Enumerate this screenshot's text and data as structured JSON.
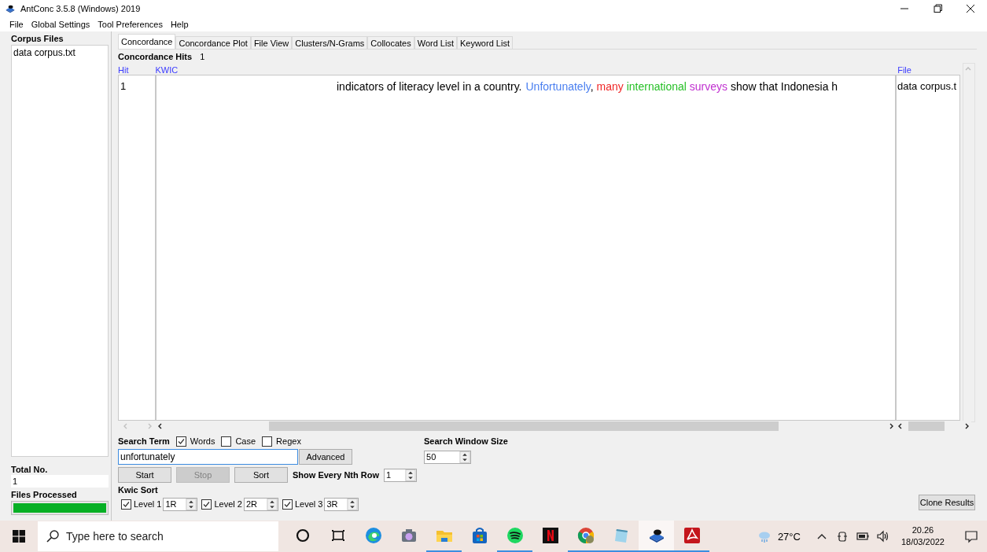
{
  "window": {
    "title": "AntConc 3.5.8 (Windows) 2019"
  },
  "menu": [
    "File",
    "Global Settings",
    "Tool Preferences",
    "Help"
  ],
  "corpus_files": {
    "heading": "Corpus Files",
    "files": [
      "data corpus.txt"
    ]
  },
  "total": {
    "label": "Total No.",
    "value": "1"
  },
  "files_processed": {
    "label": "Files Processed",
    "level": 1
  },
  "tabs": [
    {
      "label": "Concordance",
      "selected": true
    },
    {
      "label": "Concordance Plot",
      "selected": false
    },
    {
      "label": "File View",
      "selected": false
    },
    {
      "label": "Clusters/N-Grams",
      "selected": false
    },
    {
      "label": "Collocates",
      "selected": false
    },
    {
      "label": "Word List",
      "selected": false
    },
    {
      "label": "Keyword List",
      "selected": false
    }
  ],
  "hits": {
    "label": "Concordance Hits",
    "value": "1"
  },
  "table": {
    "columns": [
      "Hit",
      "KWIC",
      "File"
    ],
    "rows": [
      {
        "hit": "1",
        "left": "indicators of literacy level in a country.",
        "right": [
          {
            "text": "Unfortunately",
            "color": "#4a7ff0"
          },
          {
            "text": ","
          },
          {
            "text": "many",
            "color": "#f02828"
          },
          {
            "text": "international",
            "color": "#28c028"
          },
          {
            "text": "surveys",
            "color": "#c030d0"
          },
          {
            "text": "show that Indonesia h"
          }
        ],
        "file": "data corpus.t"
      }
    ]
  },
  "search": {
    "label": "Search Term",
    "options": [
      {
        "label": "Words",
        "checked": true
      },
      {
        "label": "Case",
        "checked": false
      },
      {
        "label": "Regex",
        "checked": false
      }
    ],
    "value": "unfortunately",
    "advanced": "Advanced"
  },
  "buttons": [
    {
      "label": "Start",
      "disabled": false
    },
    {
      "label": "Stop",
      "disabled": true
    },
    {
      "label": "Sort",
      "disabled": false
    }
  ],
  "nth_row": {
    "label": "Show Every Nth Row",
    "value": "1"
  },
  "window_size": {
    "label": "Search Window Size",
    "value": "50"
  },
  "kwic_sort": {
    "label": "Kwic Sort",
    "levels": [
      {
        "label": "Level 1",
        "checked": true,
        "value": "1R"
      },
      {
        "label": "Level 2",
        "checked": true,
        "value": "2R"
      },
      {
        "label": "Level 3",
        "checked": true,
        "value": "3R"
      }
    ]
  },
  "clone_button": "Clone Results",
  "taskbar": {
    "search_placeholder": "Type here to search",
    "apps": [
      {
        "kind": "cortana",
        "running": false,
        "selected": false
      },
      {
        "kind": "taskview",
        "running": false,
        "selected": false
      },
      {
        "kind": "edge",
        "running": false,
        "selected": false
      },
      {
        "kind": "camera",
        "running": false,
        "selected": false
      },
      {
        "kind": "explorer",
        "running": true,
        "selected": false
      },
      {
        "kind": "store",
        "running": false,
        "selected": false
      },
      {
        "kind": "spotify",
        "running": true,
        "selected": false
      },
      {
        "kind": "netflix",
        "running": false,
        "selected": false
      },
      {
        "kind": "chrome",
        "running": true,
        "selected": false
      },
      {
        "kind": "notepad",
        "running": true,
        "selected": false
      },
      {
        "kind": "antconc",
        "running": true,
        "selected": true
      },
      {
        "kind": "acrobat",
        "running": true,
        "selected": false
      }
    ],
    "temperature": "27°C",
    "time": "20.26",
    "date": "18/03/2022"
  }
}
